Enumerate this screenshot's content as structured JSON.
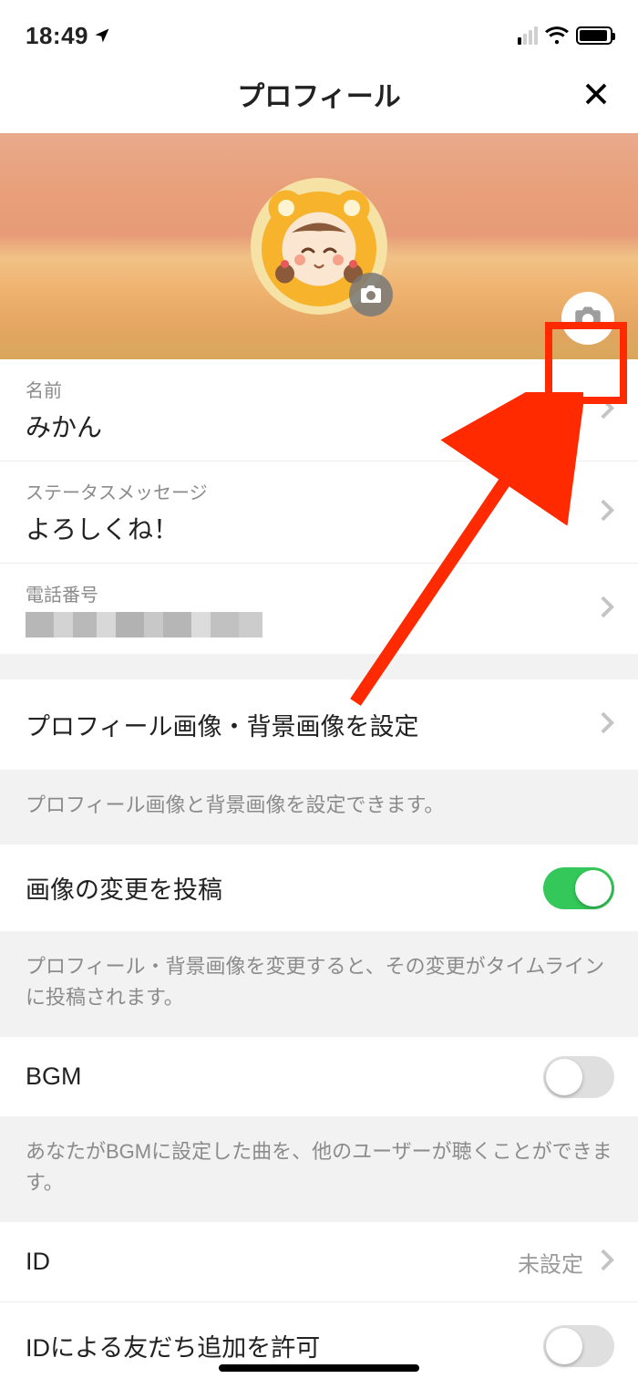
{
  "status_bar": {
    "time": "18:49"
  },
  "header": {
    "title": "プロフィール"
  },
  "profile": {
    "name_label": "名前",
    "name_value": "みかん",
    "status_label": "ステータスメッセージ",
    "status_value": "よろしくね！",
    "phone_label": "電話番号"
  },
  "section_images": {
    "title": "プロフィール画像・背景画像を設定",
    "note": "プロフィール画像と背景画像を設定できます。"
  },
  "section_post": {
    "title": "画像の変更を投稿",
    "toggle_on": true,
    "note": "プロフィール・背景画像を変更すると、その変更がタイムラインに投稿されます。"
  },
  "section_bgm": {
    "title": "BGM",
    "toggle_on": false,
    "note": "あなたがBGMに設定した曲を、他のユーザーが聴くことができます。"
  },
  "section_id": {
    "title": "ID",
    "value": "未設定"
  },
  "section_id_allow": {
    "title": "IDによる友だち追加を許可",
    "toggle_on": false
  }
}
